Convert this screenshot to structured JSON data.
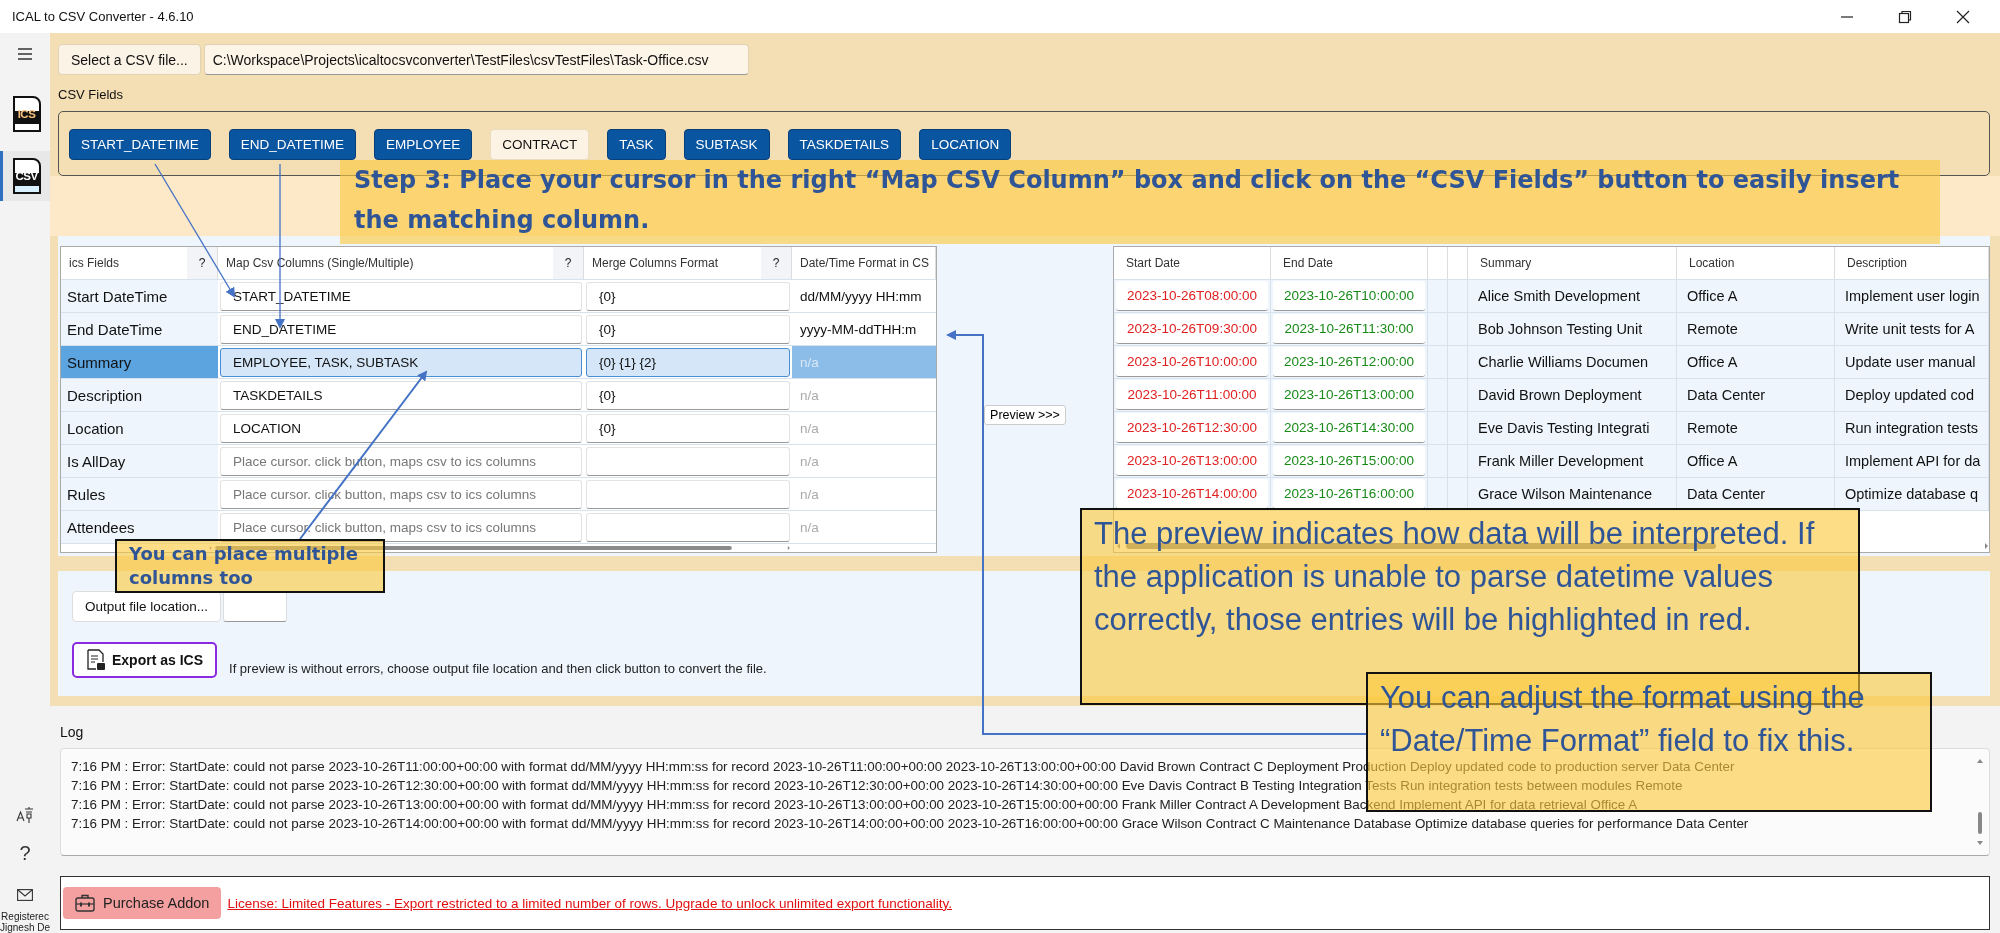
{
  "window": {
    "title": "ICAL to CSV Converter -  4.6.10"
  },
  "sidebar": {
    "items": [
      {
        "label": "ICS",
        "selected": false
      },
      {
        "label": "CSV",
        "selected": true
      }
    ],
    "help": "?",
    "user": [
      "Registerec",
      "Jignesh De"
    ]
  },
  "file": {
    "button": "Select a CSV file...",
    "path": "C:\\Workspace\\Projects\\icaltocsvconverter\\TestFiles\\csvTestFiles\\Task-Office.csv"
  },
  "csv_fields": {
    "label": "CSV Fields",
    "fields": [
      {
        "label": "START_DATETIME",
        "mapped": true
      },
      {
        "label": "END_DATETIME",
        "mapped": true
      },
      {
        "label": "EMPLOYEE",
        "mapped": true
      },
      {
        "label": "CONTRACT",
        "mapped": false
      },
      {
        "label": "TASK",
        "mapped": true
      },
      {
        "label": "SUBTASK",
        "mapped": true
      },
      {
        "label": "TASKDETAILS",
        "mapped": true
      },
      {
        "label": "LOCATION",
        "mapped": true
      }
    ]
  },
  "mapping_grid": {
    "columns": [
      {
        "label": "ics Fields",
        "help": "?"
      },
      {
        "label": "Map Csv Columns (Single/Multiple)",
        "help": "?"
      },
      {
        "label": "Merge Columns Format",
        "help": "?"
      },
      {
        "label": "Date/Time Format in CS"
      }
    ],
    "rows": [
      {
        "field": "Start DateTime",
        "selected": false,
        "mapping": {
          "value": "START_DATETIME"
        },
        "merge": "{0}",
        "format": {
          "text": "dd/MM/yyyy HH:mm",
          "disabled": false
        }
      },
      {
        "field": "End DateTime",
        "selected": false,
        "mapping": {
          "value": "END_DATETIME"
        },
        "merge": "{0}",
        "format": {
          "text": "yyyy-MM-ddTHH:m",
          "disabled": false
        }
      },
      {
        "field": "Summary",
        "selected": true,
        "mapping": {
          "value": "EMPLOYEE, TASK, SUBTASK"
        },
        "merge": "{0} {1} {2}",
        "format": {
          "text": "n/a",
          "disabled": true
        }
      },
      {
        "field": "Description",
        "selected": false,
        "mapping": {
          "value": "TASKDETAILS"
        },
        "merge": "{0}",
        "format": {
          "text": "n/a",
          "disabled": true
        }
      },
      {
        "field": "Location",
        "selected": false,
        "mapping": {
          "value": "LOCATION"
        },
        "merge": "{0}",
        "format": {
          "text": "n/a",
          "disabled": true
        }
      },
      {
        "field": "Is AllDay",
        "selected": false,
        "mapping": {
          "placeholder": "Place cursor. click button, maps csv to ics columns"
        },
        "format": {
          "text": "n/a",
          "disabled": true
        }
      },
      {
        "field": "Rules",
        "selected": false,
        "mapping": {
          "placeholder": "Place cursor. click button, maps csv to ics columns"
        },
        "format": {
          "text": "n/a",
          "disabled": true
        }
      },
      {
        "field": "Attendees",
        "selected": false,
        "mapping": {
          "placeholder": "Place cursor. click button, maps csv to ics columns"
        },
        "format": {
          "text": "n/a",
          "disabled": true
        }
      }
    ]
  },
  "preview_button": "Preview >>>",
  "preview_grid": {
    "columns": [
      {
        "kind": "text",
        "label": "Start Date"
      },
      {
        "kind": "text",
        "label": "End Date"
      },
      {
        "kind": "blank"
      },
      {
        "kind": "blank"
      },
      {
        "kind": "text",
        "label": "Summary"
      },
      {
        "kind": "text",
        "label": "Location"
      },
      {
        "kind": "text",
        "label": "Description"
      }
    ],
    "rows": [
      {
        "start": {
          "text": "2023-10-26T08:00:00",
          "error": true
        },
        "end": {
          "text": "2023-10-26T10:00:00",
          "error": false
        },
        "summary": "Alice Smith Development",
        "location": "Office A",
        "description": "Implement user login"
      },
      {
        "start": {
          "text": "2023-10-26T09:30:00",
          "error": true
        },
        "end": {
          "text": "2023-10-26T11:30:00",
          "error": false
        },
        "summary": "Bob Johnson Testing Unit",
        "location": "Remote",
        "description": "Write unit tests for A"
      },
      {
        "start": {
          "text": "2023-10-26T10:00:00",
          "error": true
        },
        "end": {
          "text": "2023-10-26T12:00:00",
          "error": false
        },
        "summary": "Charlie Williams Documen",
        "location": "Office A",
        "description": "Update user manual"
      },
      {
        "start": {
          "text": "2023-10-26T11:00:00",
          "error": true
        },
        "end": {
          "text": "2023-10-26T13:00:00",
          "error": false
        },
        "summary": "David Brown Deployment",
        "location": "Data Center",
        "description": "Deploy updated cod"
      },
      {
        "start": {
          "text": "2023-10-26T12:30:00",
          "error": true
        },
        "end": {
          "text": "2023-10-26T14:30:00",
          "error": false
        },
        "summary": "Eve Davis Testing Integrati",
        "location": "Remote",
        "description": "Run integration tests"
      },
      {
        "start": {
          "text": "2023-10-26T13:00:00",
          "error": true
        },
        "end": {
          "text": "2023-10-26T15:00:00",
          "error": false
        },
        "summary": "Frank Miller Development",
        "location": "Office A",
        "description": "Implement API for da"
      },
      {
        "start": {
          "text": "2023-10-26T14:00:00",
          "error": true
        },
        "end": {
          "text": "2023-10-26T16:00:00",
          "error": false
        },
        "summary": "Grace Wilson Maintenance",
        "location": "Data Center",
        "description": "Optimize database q"
      }
    ]
  },
  "output": {
    "button": "Output file location..."
  },
  "export": {
    "button": "Export as ICS",
    "hint": "If preview is without errors, choose output file location and then click button to convert the file."
  },
  "log": {
    "label": "Log",
    "lines": [
      "7:16 PM : Error: StartDate: could not parse 2023-10-26T11:00:00+00:00 with format dd/MM/yyyy HH:mm:ss for record 2023-10-26T11:00:00+00:00 2023-10-26T13:00:00+00:00 David Brown Contract C Deployment Production Deploy updated code to production server Data Center",
      "7:16 PM : Error: StartDate: could not parse 2023-10-26T12:30:00+00:00 with format dd/MM/yyyy HH:mm:ss for record 2023-10-26T12:30:00+00:00 2023-10-26T14:30:00+00:00 Eve Davis Contract B Testing Integration Tests Run integration tests between modules Remote",
      "7:16 PM : Error: StartDate: could not parse 2023-10-26T13:00:00+00:00 with format dd/MM/yyyy HH:mm:ss for record 2023-10-26T13:00:00+00:00 2023-10-26T15:00:00+00:00 Frank Miller Contract A Development Backend Implement API for data retrieval Office A",
      "7:16 PM : Error: StartDate: could not parse 2023-10-26T14:00:00+00:00 with format dd/MM/yyyy HH:mm:ss for record 2023-10-26T14:00:00+00:00 2023-10-26T16:00:00+00:00 Grace Wilson Contract C Maintenance Database Optimize database queries for performance Data Center"
    ]
  },
  "license": {
    "button": "Purchase Addon",
    "message": "License: Limited Features - Export restricted to a limited number of rows. Upgrade to unlock unlimited export functionality."
  },
  "annotations": [
    {
      "kind": "banner",
      "text": "Step 3: Place your cursor in the right “Map CSV Column” box and click on the “CSV Fields” button to easily insert the matching column."
    },
    {
      "kind": "note",
      "text": "You can place multiple columns too"
    },
    {
      "kind": "large",
      "text": "The preview indicates how data will be interpreted. If the application is unable to parse datetime values correctly, those entries will be highlighted in red."
    },
    {
      "kind": "large",
      "text": "You can adjust the format using the “Date/Time Format” field to fix this."
    }
  ]
}
